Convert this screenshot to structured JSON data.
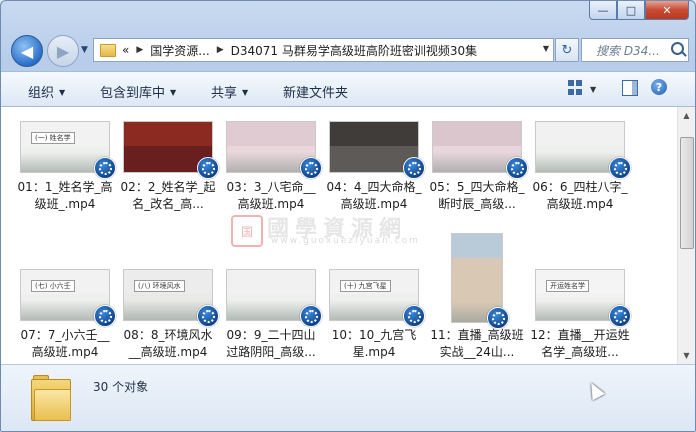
{
  "window": {
    "minimize_glyph": "—",
    "maximize_glyph": "□",
    "close_glyph": "✕"
  },
  "nav": {
    "overflow": "«",
    "breadcrumb": [
      "国学资源...",
      "D34071 马群易学高级班高阶班密训视频30集"
    ],
    "refresh_glyph": "↻",
    "search_placeholder": "搜索 D34..."
  },
  "toolbar": {
    "organize": "组织",
    "include_library": "包含到库中",
    "share": "共享",
    "new_folder": "新建文件夹",
    "help_glyph": "?"
  },
  "files": [
    {
      "label": "01：1_姓名学_高级班_.mp4",
      "caption": "(一) 姓名学"
    },
    {
      "label": "02：2_姓名学_起名_改名_高...",
      "caption": ""
    },
    {
      "label": "03：3_八宅命__高级班.mp4",
      "caption": ""
    },
    {
      "label": "04：4_四大命格_高级班.mp4",
      "caption": ""
    },
    {
      "label": "05：5_四大命格_断时辰_高级...",
      "caption": ""
    },
    {
      "label": "06：6_四柱八字_高级班.mp4",
      "caption": ""
    },
    {
      "label": "07：7_小六壬__高级班.mp4",
      "caption": "(七) 小六壬"
    },
    {
      "label": "08：8_环境风水__高级班.mp4",
      "caption": "(八) 环境风水"
    },
    {
      "label": "09：9_二十四山过路阴阳_高级...",
      "caption": ""
    },
    {
      "label": "10：10_九宫飞星.mp4",
      "caption": "(十) 九宫飞星"
    },
    {
      "label": "11：直播_高级班实战__24山...",
      "caption": ""
    },
    {
      "label": "12：直播__开运姓名学_高级班...",
      "caption": "开运姓名学"
    }
  ],
  "watermark": {
    "seal": "国",
    "big": "國學資源網",
    "small": "www.guoxueziyuan.com"
  },
  "status": {
    "count": "30 个对象"
  },
  "colors": {
    "accent": "#2b6fc9",
    "close": "#c74a32",
    "badge": "#0c3f86"
  }
}
